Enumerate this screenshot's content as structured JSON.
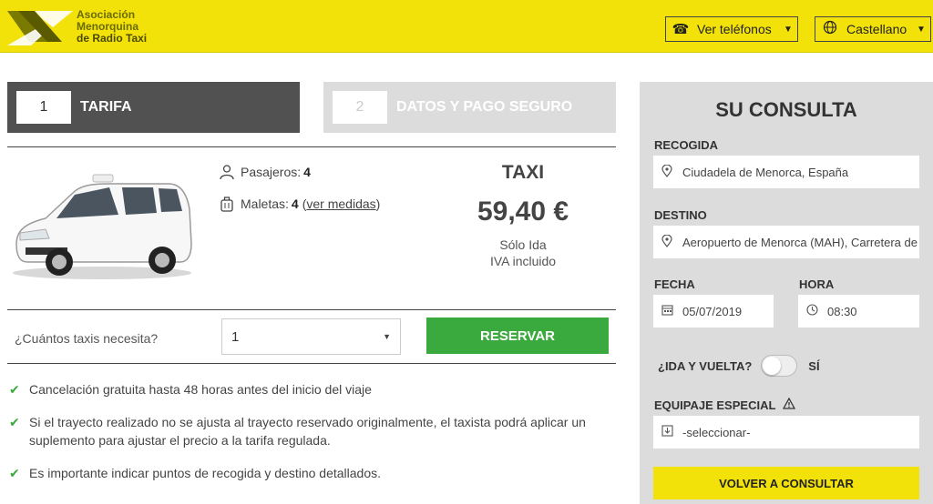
{
  "header": {
    "logo_lines": [
      "Asociación",
      "Menorquina",
      "de Radio Taxi"
    ],
    "phones_label": "Ver teléfonos",
    "language_label": "Castellano"
  },
  "steps": [
    {
      "number": "1",
      "label": "TARIFA"
    },
    {
      "number": "2",
      "label": "DATOS Y PAGO SEGURO"
    }
  ],
  "offer": {
    "passengers_label": "Pasajeros:",
    "passengers_value": "4",
    "luggage_label": "Maletas:",
    "luggage_value": "4",
    "luggage_link_open": "(",
    "luggage_link": "ver medidas",
    "luggage_link_close": ")",
    "vehicle_type": "TAXI",
    "price": "59,40 €",
    "trip_type": "Sólo Ida",
    "tax_note": "IVA incluido"
  },
  "booking": {
    "qty_label": "¿Cuántos taxis necesita?",
    "qty_value": "1",
    "reserve_label": "RESERVAR"
  },
  "notes": [
    "Cancelación gratuita hasta 48 horas antes del inicio del viaje",
    "Si el trayecto realizado no se ajusta al trayecto reservado originalmente, el taxista podrá aplicar un suplemento para ajustar el precio a la tarifa regulada.",
    "Es importante indicar puntos de recogida y destino detallados."
  ],
  "sidebar": {
    "title": "SU CONSULTA",
    "pickup_label": "RECOGIDA",
    "pickup_value": "Ciudadela de Menorca, España",
    "dest_label": "DESTINO",
    "dest_value": "Aeropuerto de Menorca (MAH), Carretera de Sant Climent",
    "date_label": "FECHA",
    "date_value": "05/07/2019",
    "time_label": "HORA",
    "time_value": "08:30",
    "round_trip_label": "¿IDA Y VUELTA?",
    "round_trip_yes": "SÍ",
    "luggage_label": "EQUIPAJE ESPECIAL",
    "luggage_placeholder": "-seleccionar-",
    "back_label": "VOLVER A CONSULTAR"
  },
  "colors": {
    "brand_yellow": "#f2e20a",
    "active_step": "#515151",
    "inactive_step": "#dcdcdc",
    "reserve_green": "#3aaa3e",
    "sidebar_bg": "#dcdcdc"
  },
  "icons": {
    "phone": "phone-icon",
    "globe": "globe-icon",
    "user": "user-icon",
    "suitcase": "suitcase-icon",
    "pin": "location-pin-icon",
    "calendar": "calendar-icon",
    "clock": "clock-icon",
    "warning": "warning-icon",
    "check": "check-icon"
  }
}
